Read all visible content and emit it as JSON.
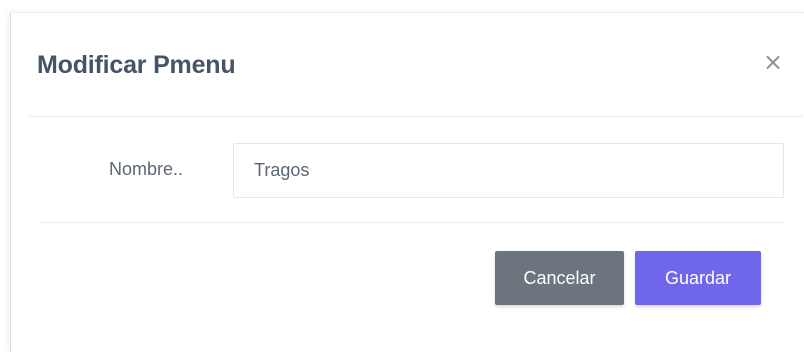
{
  "modal": {
    "title": "Modificar Pmenu",
    "close_label": "×"
  },
  "form": {
    "nombre_label": "Nombre..",
    "nombre_value": "Tragos"
  },
  "footer": {
    "cancel_label": "Cancelar",
    "save_label": "Guardar"
  },
  "colors": {
    "title": "#475466",
    "cancel_button": "#6c757e",
    "save_button": "#7066ec"
  }
}
